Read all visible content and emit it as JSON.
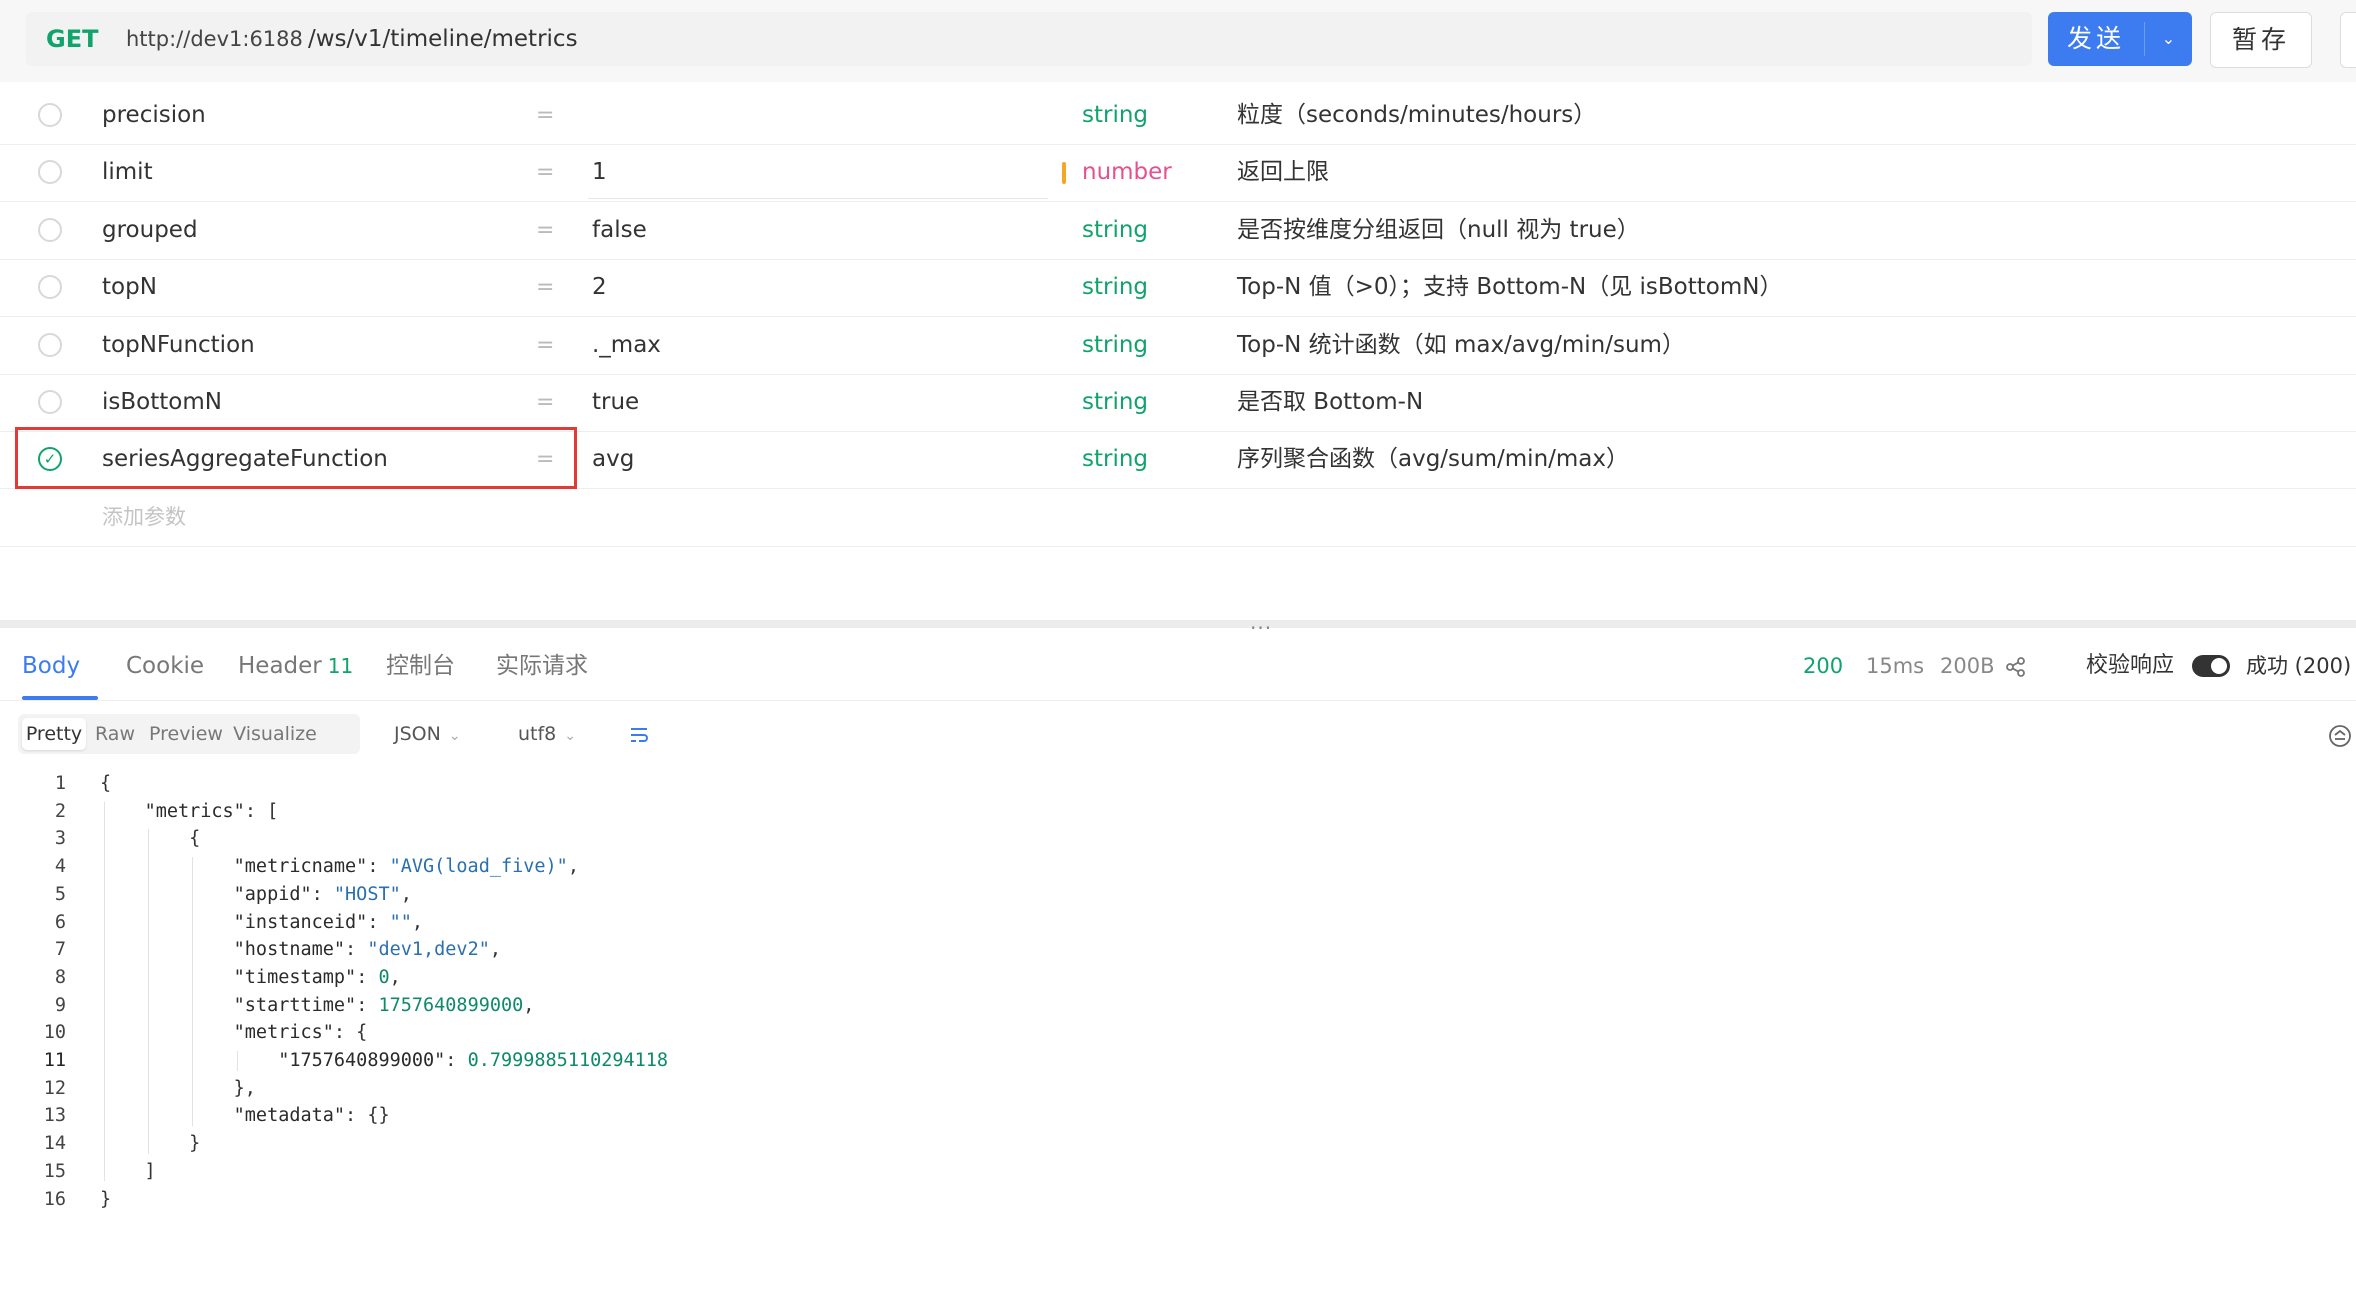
{
  "request": {
    "method": "GET",
    "host": "http://dev1:6188",
    "path": "/ws/v1/timeline/metrics",
    "send_label": "发送",
    "save_label": "暂存"
  },
  "params": [
    {
      "key": "precision",
      "value": "",
      "type": "string",
      "desc": "粒度（seconds/minutes/hours）",
      "checked": false
    },
    {
      "key": "limit",
      "value": "1",
      "type": "number",
      "desc": "返回上限",
      "checked": false
    },
    {
      "key": "grouped",
      "value": "false",
      "type": "string",
      "desc": "是否按维度分组返回（null 视为 true）",
      "checked": false
    },
    {
      "key": "topN",
      "value": "2",
      "type": "string",
      "desc": "Top-N 值（>0）；支持 Bottom-N（见 isBottomN）",
      "checked": false
    },
    {
      "key": "topNFunction",
      "value": "._max",
      "type": "string",
      "desc": "Top-N 统计函数（如 max/avg/min/sum）",
      "checked": false
    },
    {
      "key": "isBottomN",
      "value": "true",
      "type": "string",
      "desc": "是否取 Bottom-N",
      "checked": false
    },
    {
      "key": "seriesAggregateFunction",
      "value": "avg",
      "type": "string",
      "desc": "序列聚合函数（avg/sum/min/max）",
      "checked": true
    }
  ],
  "param_eq": "=",
  "add_param_placeholder": "添加参数",
  "response_tabs": [
    {
      "label": "Body",
      "active": true
    },
    {
      "label": "Cookie"
    },
    {
      "label": "Header",
      "badge": "11"
    },
    {
      "label": "控制台"
    },
    {
      "label": "实际请求"
    }
  ],
  "status": {
    "code": "200",
    "time": "15ms",
    "size": "200B",
    "verify_label": "校验响应",
    "result": "成功 (200)"
  },
  "format_toolbar": {
    "views": [
      "Pretty",
      "Raw",
      "Preview",
      "Visualize"
    ],
    "active_view": "Pretty",
    "format": "JSON",
    "encoding": "utf8"
  },
  "code_lines": [
    "{",
    "    \"metrics\": [",
    "        {",
    "            \"metricname\": \"AVG(load_five)\",",
    "            \"appid\": \"HOST\",",
    "            \"instanceid\": \"\",",
    "            \"hostname\": \"dev1,dev2\",",
    "            \"timestamp\": 0,",
    "            \"starttime\": 1757640899000,",
    "            \"metrics\": {",
    "                \"1757640899000\": 0.7999885110294118",
    "            },",
    "            \"metadata\": {}",
    "        }",
    "    ]",
    "}"
  ],
  "colors": {
    "accent": "#3d7bf0",
    "method_get": "#10a36c",
    "type_string": "#10a36c",
    "type_number": "#e5508d",
    "highlight_box": "#e53935"
  },
  "icons": {
    "send_dropdown": "chevron-down-icon",
    "share": "share-icon",
    "wrap": "wrap-lines-icon",
    "collapse": "collapse-icon",
    "checkbox_checked": "check-circle-icon"
  }
}
